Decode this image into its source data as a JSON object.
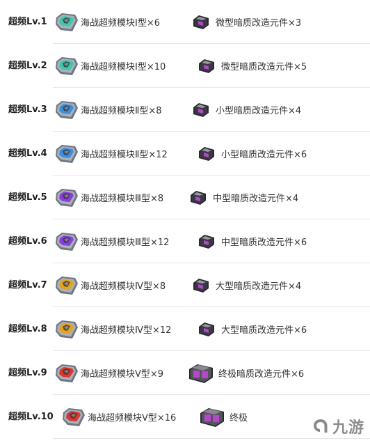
{
  "colors": {
    "tier_1": "#3ec7a8",
    "tier_2": "#3b8fdc",
    "tier_3": "#8a3fd6",
    "tier_4": "#e6a21f",
    "tier_5": "#d9362e",
    "dark_part": "#3a3842",
    "dark_part_accent": "#b548c9"
  },
  "rows": [
    {
      "level": "超频Lv.1",
      "module": "海战超频模块Ⅰ型×6",
      "part": "微型暗质改造元件×3",
      "tier": "tier_1",
      "part_size": "small"
    },
    {
      "level": "超频Lv.2",
      "module": "海战超频模块Ⅰ型×10",
      "part": "微型暗质改造元件×5",
      "tier": "tier_1",
      "part_size": "small"
    },
    {
      "level": "超频Lv.3",
      "module": "海战超频模块Ⅱ型×8",
      "part": "小型暗质改造元件×4",
      "tier": "tier_2",
      "part_size": "small"
    },
    {
      "level": "超频Lv.4",
      "module": "海战超频模块Ⅱ型×12",
      "part": "小型暗质改造元件×6",
      "tier": "tier_2",
      "part_size": "small"
    },
    {
      "level": "超频Lv.5",
      "module": "海战超频模块Ⅲ型×8",
      "part": "中型暗质改造元件×4",
      "tier": "tier_3",
      "part_size": "small"
    },
    {
      "level": "超频Lv.6",
      "module": "海战超频模块Ⅲ型×12",
      "part": "中型暗质改造元件×6",
      "tier": "tier_3",
      "part_size": "small"
    },
    {
      "level": "超频Lv.7",
      "module": "海战超频模块Ⅳ型×8",
      "part": "大型暗质改造元件×4",
      "tier": "tier_4",
      "part_size": "small"
    },
    {
      "level": "超频Lv.8",
      "module": "海战超频模块Ⅳ型×12",
      "part": "大型暗质改造元件×6",
      "tier": "tier_4",
      "part_size": "small"
    },
    {
      "level": "超频Lv.9",
      "module": "海战超频模块Ⅴ型×9",
      "part": "终极暗质改造元件×6",
      "tier": "tier_5",
      "part_size": "big"
    },
    {
      "level": "超频Lv.10",
      "module": "海战超频模块Ⅴ型×16",
      "part": "终极",
      "tier": "tier_5",
      "part_size": "big"
    }
  ],
  "watermark": {
    "text": "九游",
    "icon": "jiuyou-logo-icon"
  }
}
